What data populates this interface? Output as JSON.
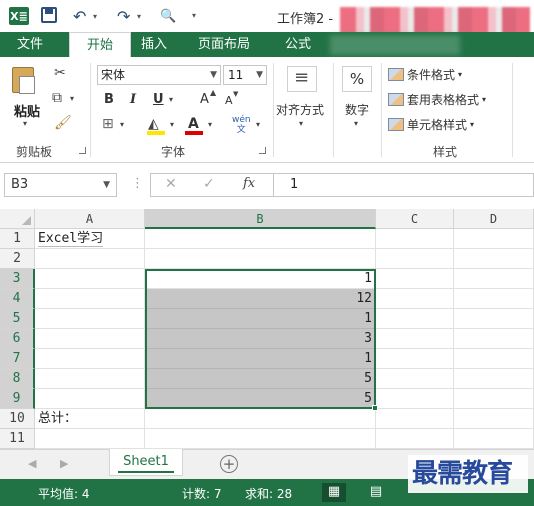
{
  "titlebar": {
    "app_logo": "X≣",
    "title": "工作簿2 -",
    "undo_glyph": "↶",
    "redo_glyph": "↷",
    "preview_glyph": "🔍",
    "icons": [
      "excel-logo-icon",
      "save-icon",
      "undo-icon",
      "redo-icon",
      "print-preview-icon",
      "customize-icon"
    ]
  },
  "ribbon_tabs": [
    "文件",
    "开始",
    "插入",
    "页面布局",
    "公式"
  ],
  "ribbon": {
    "clipboard": {
      "paste_label": "粘贴",
      "group_label": "剪贴板"
    },
    "font": {
      "font_name": "宋体",
      "font_size": "11",
      "bold": "B",
      "italic": "I",
      "underline": "U",
      "grow": "A",
      "shrink": "A",
      "phonetic": "wén\n文",
      "group_label": "字体"
    },
    "alignment": {
      "label": "对齐方式"
    },
    "number": {
      "symbol": "%",
      "label": "数字"
    },
    "styles": {
      "items": [
        "条件格式",
        "套用表格格式",
        "单元格样式"
      ],
      "group_label": "样式"
    }
  },
  "formula_bar": {
    "name_box": "B3",
    "cancel": "✕",
    "enter": "✓",
    "fx": "fx",
    "content": "1"
  },
  "grid": {
    "columns": [
      "A",
      "B",
      "C",
      "D"
    ],
    "selected_column": "B",
    "rows": [
      {
        "num": "1",
        "a": "Excel学习",
        "b": ""
      },
      {
        "num": "2",
        "a": "",
        "b": ""
      },
      {
        "num": "3",
        "a": "",
        "b": "1"
      },
      {
        "num": "4",
        "a": "",
        "b": "12"
      },
      {
        "num": "5",
        "a": "",
        "b": "1"
      },
      {
        "num": "6",
        "a": "",
        "b": "3"
      },
      {
        "num": "7",
        "a": "",
        "b": "1"
      },
      {
        "num": "8",
        "a": "",
        "b": "5"
      },
      {
        "num": "9",
        "a": "",
        "b": "5"
      },
      {
        "num": "10",
        "a": "总计：",
        "b": ""
      },
      {
        "num": "11",
        "a": "",
        "b": ""
      }
    ],
    "selected_rows": [
      "3",
      "4",
      "5",
      "6",
      "7",
      "8",
      "9"
    ]
  },
  "sheet_tabs": {
    "active": "Sheet1",
    "add": "+"
  },
  "status_bar": {
    "average": "平均值: 4",
    "count": "计数: 7",
    "sum": "求和: 28"
  },
  "watermark": "最需教育",
  "colors": {
    "excel_green": "#217346",
    "selection_fill": "#c6c6c6"
  }
}
